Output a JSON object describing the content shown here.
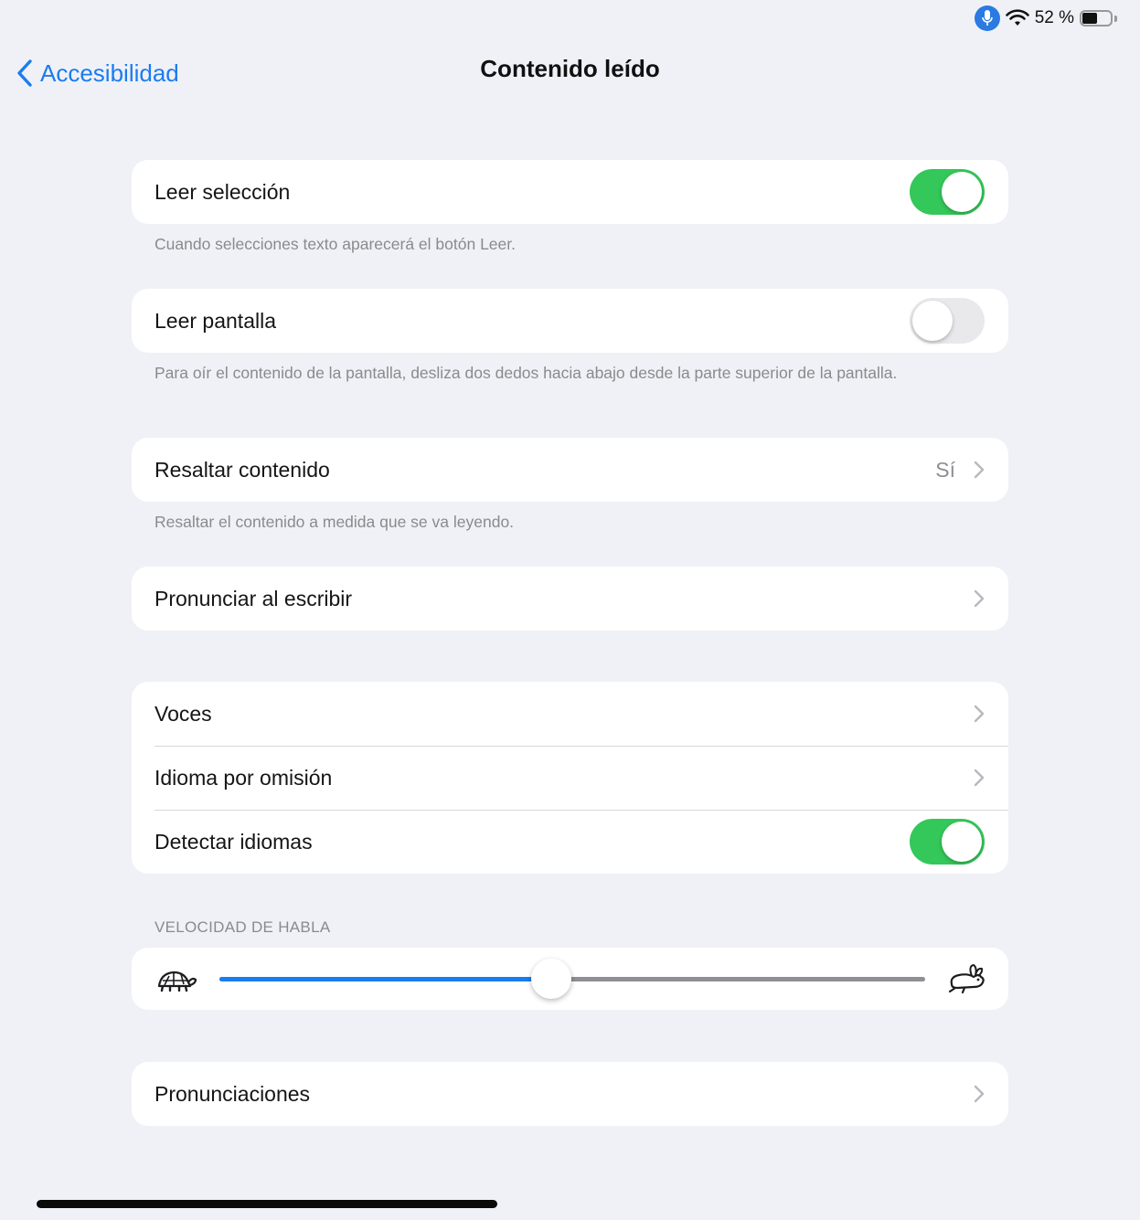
{
  "status_bar": {
    "battery_percent": "52 %",
    "battery_level": 0.52
  },
  "nav": {
    "back_label": "Accesibilidad",
    "title": "Contenido leído"
  },
  "leer_seleccion": {
    "label": "Leer selección",
    "on": true,
    "footer": "Cuando selecciones texto aparecerá el botón Leer."
  },
  "leer_pantalla": {
    "label": "Leer pantalla",
    "on": false,
    "footer": "Para oír el contenido de la pantalla, desliza dos dedos hacia abajo desde la parte superior de la pantalla."
  },
  "resaltar": {
    "label": "Resaltar contenido",
    "value": "Sí",
    "footer": "Resaltar el contenido a medida que se va leyendo."
  },
  "pronunciar": {
    "label": "Pronunciar al escribir"
  },
  "voice_group": {
    "voces": "Voces",
    "idioma": "Idioma por omisión",
    "detectar": {
      "label": "Detectar idiomas",
      "on": true
    }
  },
  "speech_rate": {
    "header": "VELOCIDAD DE HABLA",
    "value_fraction": 0.47
  },
  "pronunciaciones": {
    "label": "Pronunciaciones"
  },
  "colors": {
    "accent": "#1a7cf0",
    "toggle_on": "#34c759",
    "background": "#f0f1f6"
  },
  "icons": [
    "mic-icon",
    "wifi-icon",
    "battery-icon",
    "chevron-left-icon",
    "chevron-right-icon",
    "turtle-icon",
    "rabbit-icon"
  ]
}
